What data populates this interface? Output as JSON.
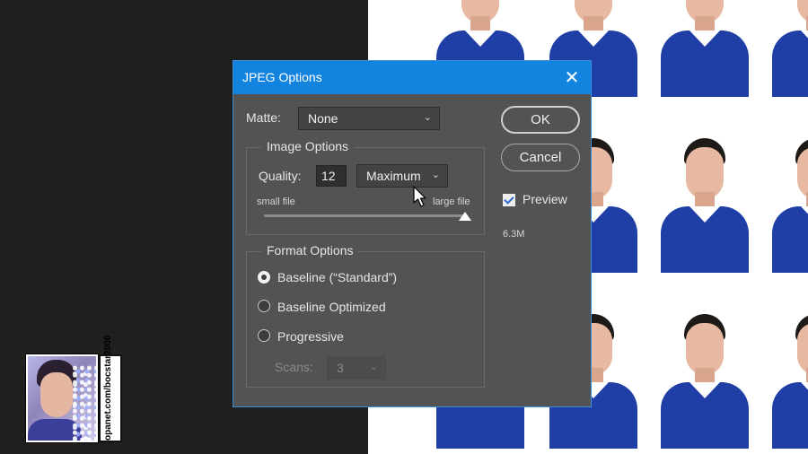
{
  "dialog": {
    "title": "JPEG Options",
    "close_glyph": "✕",
    "matte": {
      "label": "Matte:",
      "value": "None"
    },
    "image_options": {
      "legend": "Image Options",
      "quality_label": "Quality:",
      "quality_value": "12",
      "quality_preset": "Maximum",
      "small_file_label": "small file",
      "large_file_label": "large file",
      "slider_fraction": 1.0
    },
    "format_options": {
      "legend": "Format Options",
      "radios": [
        {
          "label": "Baseline (“Standard”)",
          "checked": true
        },
        {
          "label": "Baseline Optimized",
          "checked": false
        },
        {
          "label": "Progressive",
          "checked": false
        }
      ],
      "scans_label": "Scans:",
      "scans_value": "3"
    },
    "ok_label": "OK",
    "cancel_label": "Cancel",
    "preview_label": "Preview",
    "preview_checked": true,
    "file_size": "6.3M",
    "accent_color": "#1383e0"
  },
  "watermark": {
    "text": "opanet.com/bocstar2000"
  }
}
